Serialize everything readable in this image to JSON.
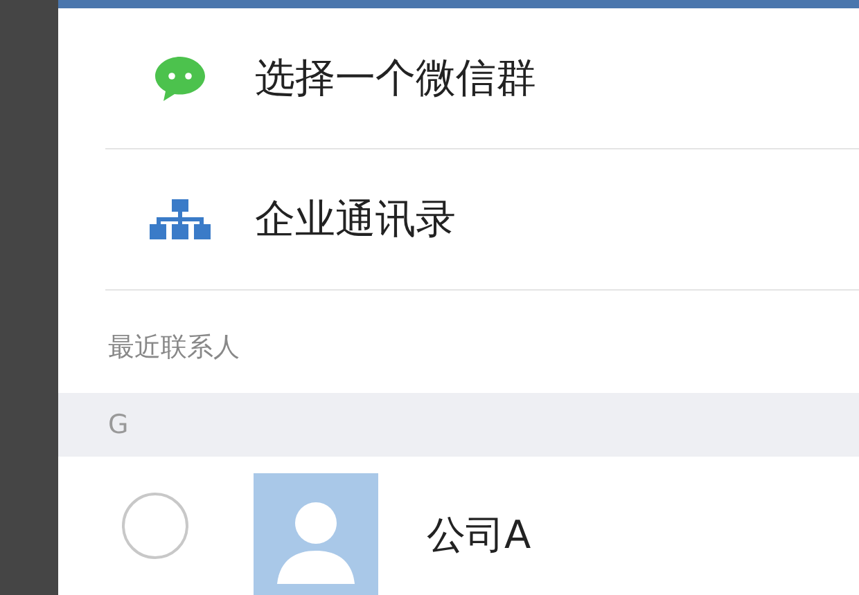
{
  "menu_items": [
    {
      "kind": "group-chat",
      "label": "选择一个微信群"
    },
    {
      "kind": "directory",
      "label": "企业通讯录"
    }
  ],
  "recent_heading": "最近联系人",
  "sections": [
    {
      "letter": "G",
      "contacts": [
        {
          "name": "公司A",
          "selected": false
        }
      ]
    }
  ]
}
